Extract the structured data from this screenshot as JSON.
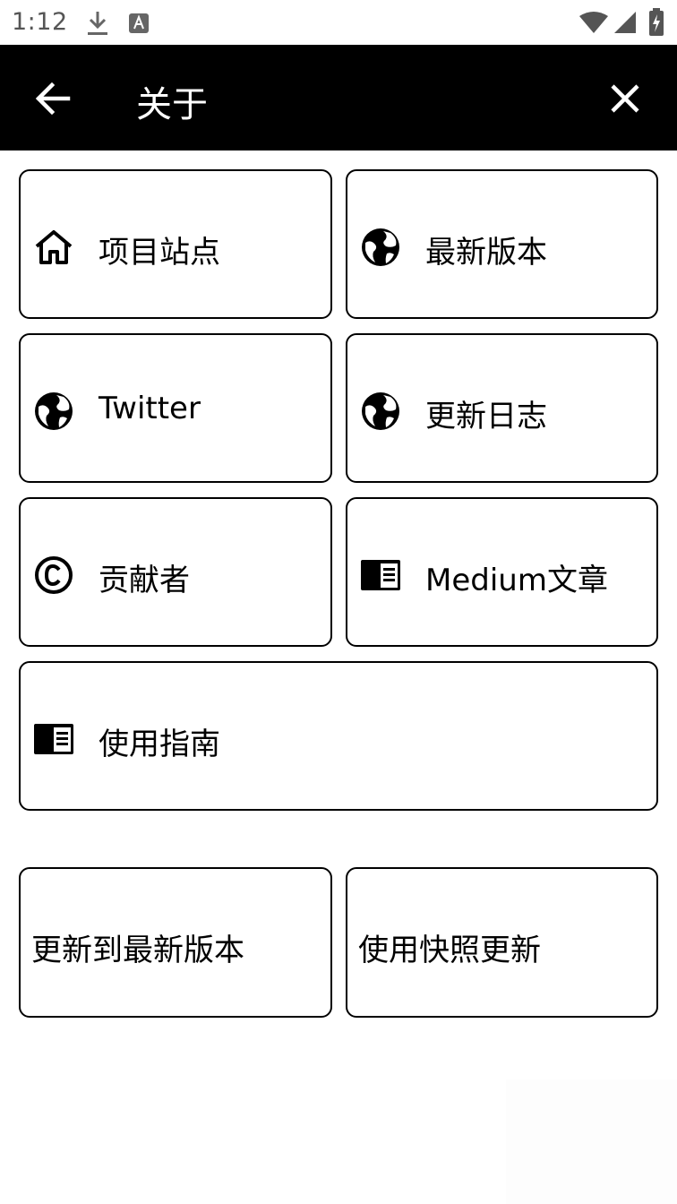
{
  "status_bar": {
    "time": "1:12"
  },
  "app_bar": {
    "title": "关于"
  },
  "links": [
    {
      "label": "项目站点",
      "icon": "home-icon"
    },
    {
      "label": "最新版本",
      "icon": "globe-icon"
    },
    {
      "label": "Twitter",
      "icon": "globe-icon"
    },
    {
      "label": "更新日志",
      "icon": "globe-icon"
    },
    {
      "label": "贡献者",
      "icon": "copyright-icon"
    },
    {
      "label": "Medium文章",
      "icon": "article-icon"
    },
    {
      "label": "使用指南",
      "icon": "article-icon"
    }
  ],
  "actions": {
    "update_latest": "更新到最新版本",
    "update_snapshot": "使用快照更新"
  }
}
